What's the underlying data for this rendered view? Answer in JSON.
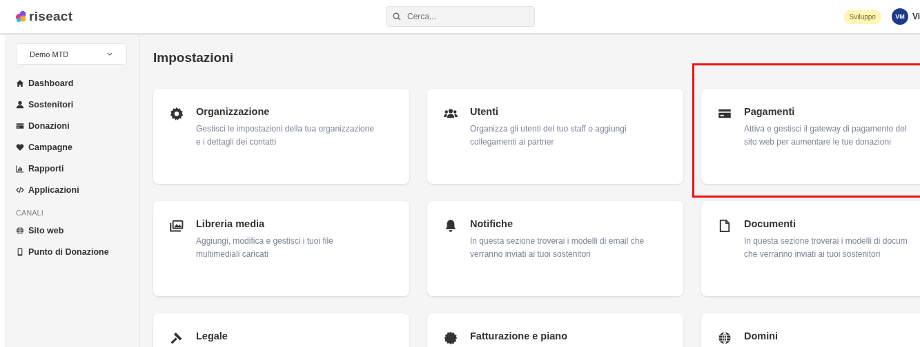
{
  "header": {
    "logo": "riseact",
    "search": {
      "placeholder": "Cerca..."
    },
    "environment_badge": "Sviluppo",
    "user": {
      "initials": "VM",
      "name": "Vi"
    }
  },
  "sidebar": {
    "organization_select": "Demo MTD",
    "items": [
      {
        "label": "Dashboard",
        "kind": "home"
      },
      {
        "label": "Sostenitori",
        "kind": "user"
      },
      {
        "label": "Donazioni",
        "kind": "card"
      },
      {
        "label": "Campagne",
        "kind": "heart"
      },
      {
        "label": "Rapporti",
        "kind": "chart"
      },
      {
        "label": "Applicazioni",
        "kind": "code"
      }
    ],
    "section_label": "CANALI",
    "channel_items": [
      {
        "label": "Sito web",
        "kind": "globe"
      },
      {
        "label": "Punto di Donazione",
        "kind": "phone"
      }
    ]
  },
  "page_title": "Impostazioni",
  "cards": [
    {
      "title": "Organizzazione",
      "kind": "gear",
      "highlighted": false,
      "description": [
        "Gestisci le impostazioni della tua organizzazione",
        "e i dettagli dei contatti"
      ]
    },
    {
      "title": "Utenti",
      "kind": "users",
      "highlighted": false,
      "description": [
        "Organizza gli utenti del tuo staff o aggiungi",
        "collegamenti ai partner"
      ]
    },
    {
      "title": "Pagamenti",
      "kind": "card",
      "highlighted": true,
      "description": [
        "Attiva e gestisci il gateway di pagamento del",
        "sito web per aumentare le tue donazioni"
      ]
    },
    {
      "title": "Libreria media",
      "kind": "images",
      "highlighted": false,
      "description": [
        "Aggiungi, modifica e gestisci i tuoi file",
        "multimediali caricati"
      ]
    },
    {
      "title": "Notifiche",
      "kind": "bell",
      "highlighted": false,
      "description": [
        "In questa sezione troverai i modelli di email che",
        "verranno inviati ai tuoi sostenitori"
      ]
    },
    {
      "title": "Documenti",
      "kind": "file",
      "highlighted": false,
      "description": [
        "In questa sezione troverai i modelli di docum",
        "che verranno inviati ai tuoi sostenitori"
      ]
    },
    {
      "title": "Legale",
      "kind": "gavel",
      "highlighted": false
    },
    {
      "title": "Fatturazione e piano",
      "kind": "seal",
      "highlighted": false
    },
    {
      "title": "Domini",
      "kind": "globe",
      "highlighted": false
    }
  ]
}
